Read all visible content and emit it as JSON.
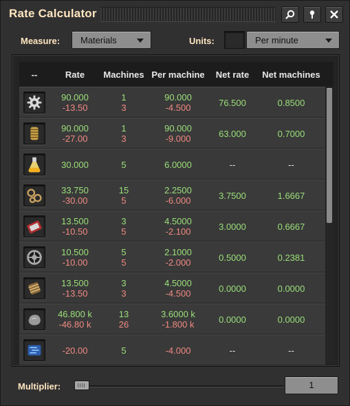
{
  "window": {
    "title": "Rate Calculator",
    "buttons": [
      {
        "name": "search-button",
        "icon": "magnifier-icon"
      },
      {
        "name": "pin-button",
        "icon": "pin-icon"
      },
      {
        "name": "close-button",
        "icon": "close-icon"
      }
    ]
  },
  "toolbar": {
    "measure_label": "Measure:",
    "measure_value": "Materials",
    "units_label": "Units:",
    "units_value": "Per minute"
  },
  "table": {
    "headers": [
      "--",
      "Rate",
      "Machines",
      "Per machine",
      "Net rate",
      "Net machines"
    ],
    "rows": [
      {
        "icon": "gear-icon",
        "rate": [
          "90.000",
          "-13.50"
        ],
        "machines": [
          "1",
          "3"
        ],
        "per_machine": [
          "90.000",
          "-4.500"
        ],
        "net_rate": "76.500",
        "net_machines": "0.8500"
      },
      {
        "icon": "copper-cable-icon",
        "rate": [
          "90.000",
          "-27.00"
        ],
        "machines": [
          "1",
          "3"
        ],
        "per_machine": [
          "90.000",
          "-9.000"
        ],
        "net_rate": "63.000",
        "net_machines": "0.7000"
      },
      {
        "icon": "lubricant-flask-icon",
        "rate": [
          "30.000"
        ],
        "machines": [
          "5"
        ],
        "per_machine": [
          "6.0000"
        ],
        "net_rate": "--",
        "net_machines": "--"
      },
      {
        "icon": "chain-icon",
        "rate": [
          "33.750",
          "-30.00"
        ],
        "machines": [
          "15",
          "5"
        ],
        "per_machine": [
          "2.2500",
          "-6.000"
        ],
        "net_rate": "3.7500",
        "net_machines": "1.6667"
      },
      {
        "icon": "engine-unit-icon",
        "rate": [
          "13.500",
          "-10.50"
        ],
        "machines": [
          "3",
          "5"
        ],
        "per_machine": [
          "4.5000",
          "-2.100"
        ],
        "net_rate": "3.0000",
        "net_machines": "0.6667"
      },
      {
        "icon": "wheel-icon",
        "rate": [
          "10.500",
          "-10.00"
        ],
        "machines": [
          "5",
          "5"
        ],
        "per_machine": [
          "2.1000",
          "-2.000"
        ],
        "net_rate": "0.5000",
        "net_machines": "0.2381"
      },
      {
        "icon": "motor-icon",
        "rate": [
          "13.500",
          "-13.50"
        ],
        "machines": [
          "3",
          "3"
        ],
        "per_machine": [
          "4.5000",
          "-4.500"
        ],
        "net_rate": "0.0000",
        "net_machines": "0.0000"
      },
      {
        "icon": "stone-icon",
        "rate": [
          "46.800 k",
          "-46.80 k"
        ],
        "machines": [
          "13",
          "26"
        ],
        "per_machine": [
          "3.6000 k",
          "-1.800 k"
        ],
        "net_rate": "0.0000",
        "net_machines": "0.0000"
      },
      {
        "icon": "circuit-icon",
        "rate": [
          "-20.00"
        ],
        "machines": [
          "5"
        ],
        "per_machine": [
          "-4.000"
        ],
        "net_rate": "--",
        "net_machines": "--"
      }
    ]
  },
  "footer": {
    "multiplier_label": "Multiplier:",
    "multiplier_value": "1",
    "slider_level": 0.0
  },
  "colors": {
    "title": "#ffe6c0",
    "positive": "#9be07a",
    "negative": "#f28a82"
  }
}
